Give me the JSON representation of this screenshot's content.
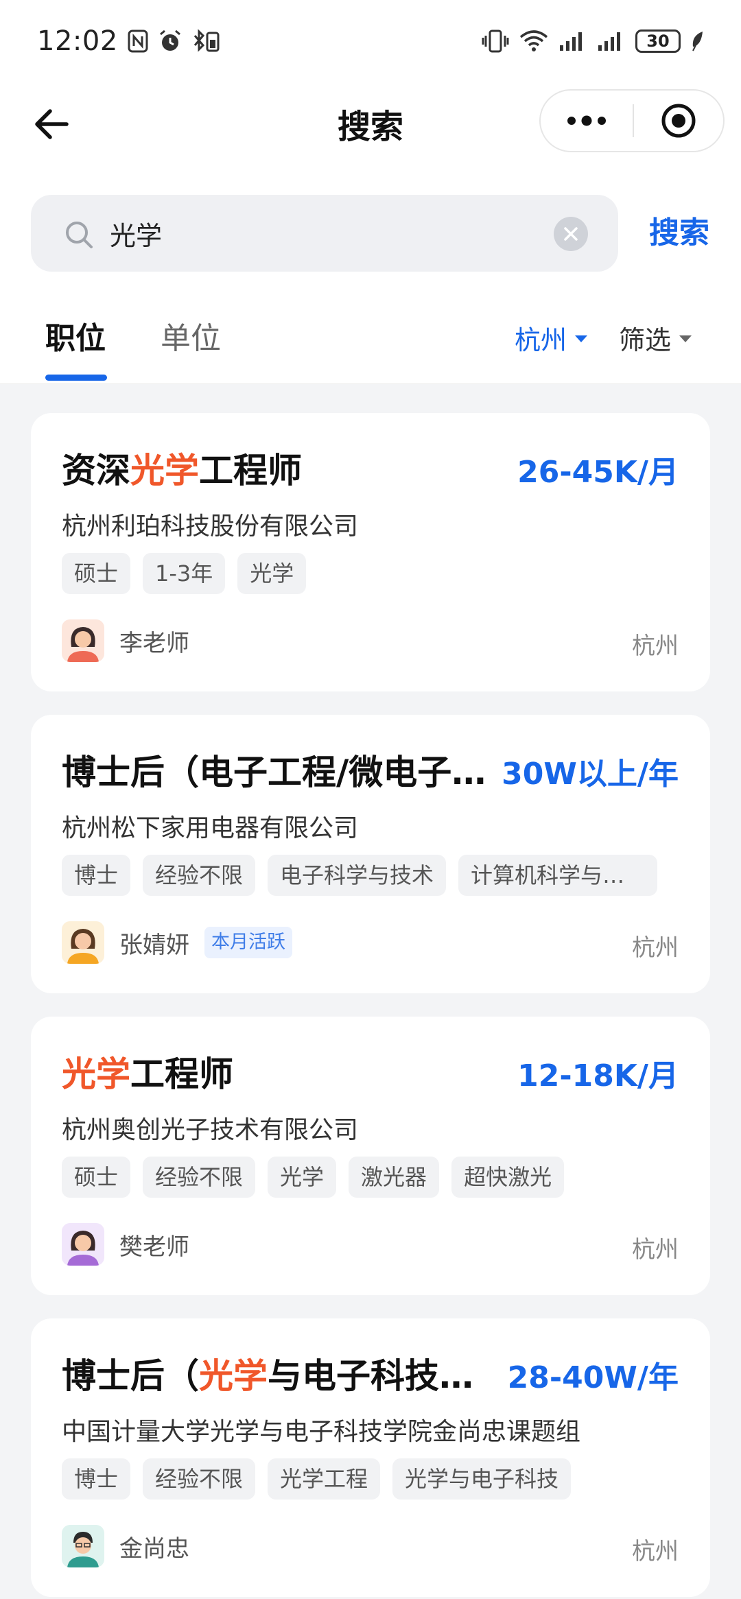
{
  "status_bar": {
    "time": "12:02",
    "battery": "30",
    "icons": [
      "nfc-icon",
      "alarm-icon",
      "bluetooth-battery-icon",
      "vibrate-icon",
      "wifi-icon",
      "signal-icon",
      "signal-icon",
      "leaf-icon"
    ]
  },
  "nav": {
    "title": "搜索",
    "back_icon": "arrow-left-icon",
    "more_icon": "more-dots-icon",
    "target_icon": "target-icon"
  },
  "search": {
    "value": "光学",
    "placeholder": "",
    "button_label": "搜索"
  },
  "tabs": [
    {
      "label": "职位",
      "active": true
    },
    {
      "label": "单位",
      "active": false
    }
  ],
  "filters": {
    "city": "杭州",
    "screen": "筛选"
  },
  "jobs": [
    {
      "title_before": "资深",
      "title_highlight": "光学",
      "title_after": "工程师",
      "salary": "26-45K/月",
      "company": "杭州利珀科技股份有限公司",
      "tags": [
        "硕士",
        "1-3年",
        "光学"
      ],
      "recruiter": "李老师",
      "badge": "",
      "location": "杭州"
    },
    {
      "title_before": "博士后（电子工程/微电子…",
      "title_highlight": "",
      "title_after": "",
      "salary": "30W以上/年",
      "company": "杭州松下家用电器有限公司",
      "tags": [
        "博士",
        "经验不限",
        "电子科学与技术",
        "计算机科学与技..."
      ],
      "recruiter": "张婧妍",
      "badge": "本月活跃",
      "location": "杭州"
    },
    {
      "title_before": "",
      "title_highlight": "光学",
      "title_after": "工程师",
      "salary": "12-18K/月",
      "company": "杭州奥创光子技术有限公司",
      "tags": [
        "硕士",
        "经验不限",
        "光学",
        "激光器",
        "超快激光"
      ],
      "recruiter": "樊老师",
      "badge": "",
      "location": "杭州"
    },
    {
      "title_before": "博士后（",
      "title_highlight": "光学",
      "title_after": "与电子科技…",
      "salary": "28-40W/年",
      "company": "中国计量大学光学与电子科技学院金尚忠课题组",
      "tags": [
        "博士",
        "经验不限",
        "光学工程",
        "光学与电子科技"
      ],
      "recruiter": "金尚忠",
      "badge": "",
      "location": "杭州"
    }
  ],
  "colors": {
    "accent": "#1766e8",
    "highlight": "#f0572a",
    "background": "#f3f4f6"
  }
}
